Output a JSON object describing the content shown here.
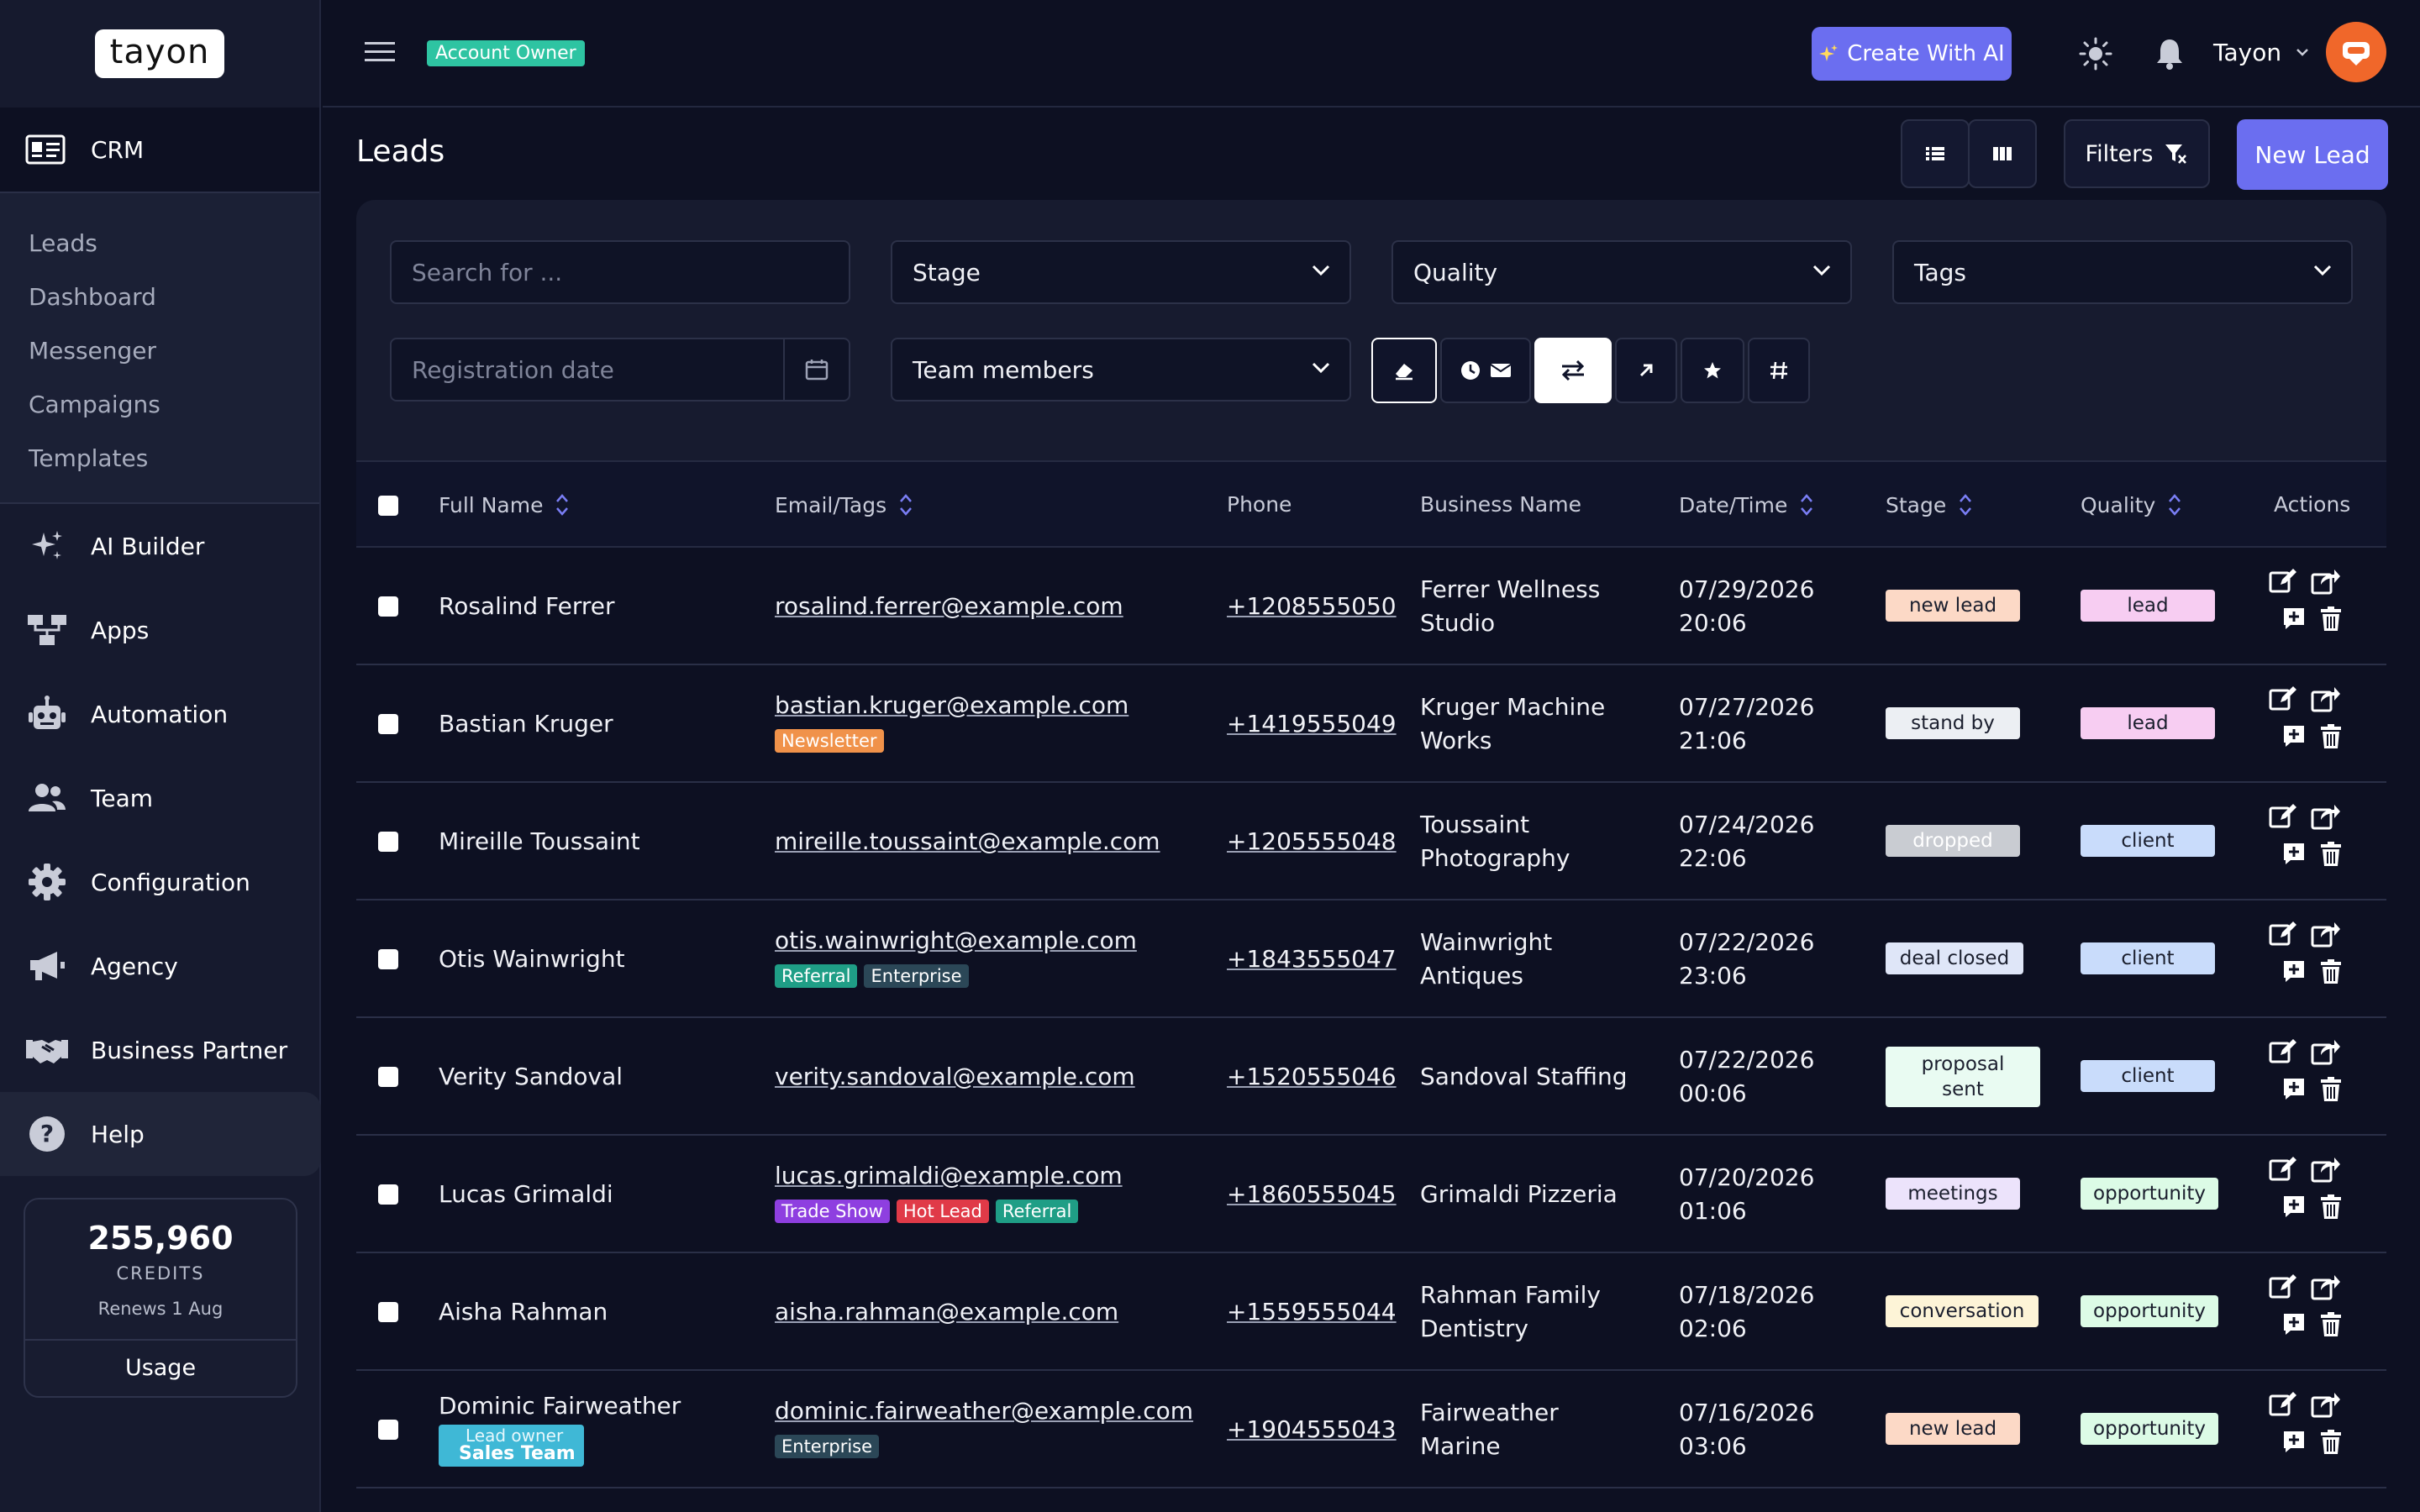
{
  "app": {
    "logo": "tayon"
  },
  "sidebar": {
    "section": "CRM",
    "sub_items": [
      "Leads",
      "Dashboard",
      "Messenger",
      "Campaigns",
      "Templates"
    ],
    "items": [
      {
        "label": "AI Builder",
        "icon": "sparkles-icon"
      },
      {
        "label": "Apps",
        "icon": "apps-icon"
      },
      {
        "label": "Automation",
        "icon": "robot-icon"
      },
      {
        "label": "Team",
        "icon": "team-icon"
      },
      {
        "label": "Configuration",
        "icon": "gear-icon"
      },
      {
        "label": "Agency",
        "icon": "megaphone-icon"
      },
      {
        "label": "Business Partner",
        "icon": "handshake-icon"
      },
      {
        "label": "Help",
        "icon": "help-icon"
      }
    ],
    "credits": {
      "value": "255,960",
      "label": "CREDITS",
      "renews": "Renews 1 Aug",
      "usage": "Usage"
    }
  },
  "topbar": {
    "badge": "Account Owner",
    "create_ai": "Create With AI",
    "user": "Tayon"
  },
  "header": {
    "title": "Leads",
    "filters": "Filters",
    "new_lead": "New Lead"
  },
  "filters": {
    "search_placeholder": "Search for ...",
    "stage": "Stage",
    "quality": "Quality",
    "tags": "Tags",
    "registration_placeholder": "Registration date",
    "team_members": "Team members"
  },
  "table": {
    "columns": [
      "Full Name",
      "Email/Tags",
      "Phone",
      "Business Name",
      "Date/Time",
      "Stage",
      "Quality",
      "Actions"
    ],
    "rows": [
      {
        "name": "Rosalind Ferrer",
        "email": "rosalind.ferrer@example.com",
        "tags": [],
        "phone": "+1208555050",
        "business": [
          "Ferrer Wellness",
          "Studio"
        ],
        "date": "07/29/2026",
        "time": "20:06",
        "stage": "new lead",
        "quality": "lead"
      },
      {
        "name": "Bastian Kruger",
        "email": "bastian.kruger@example.com",
        "tags": [
          "Newsletter"
        ],
        "phone": "+1419555049",
        "business": [
          "Kruger Machine",
          "Works"
        ],
        "date": "07/27/2026",
        "time": "21:06",
        "stage": "stand by",
        "quality": "lead"
      },
      {
        "name": "Mireille Toussaint",
        "email": "mireille.toussaint@example.com",
        "tags": [],
        "phone": "+1205555048",
        "business": [
          "Toussaint",
          "Photography"
        ],
        "date": "07/24/2026",
        "time": "22:06",
        "stage": "dropped",
        "quality": "client"
      },
      {
        "name": "Otis Wainwright",
        "email": "otis.wainwright@example.com",
        "tags": [
          "Referral",
          "Enterprise"
        ],
        "phone": "+1843555047",
        "business": [
          "Wainwright",
          "Antiques"
        ],
        "date": "07/22/2026",
        "time": "23:06",
        "stage": "deal closed",
        "quality": "client"
      },
      {
        "name": "Verity Sandoval",
        "email": "verity.sandoval@example.com",
        "tags": [],
        "phone": "+1520555046",
        "business": [
          "Sandoval Staffing"
        ],
        "date": "07/22/2026",
        "time": "00:06",
        "stage": "proposal sent",
        "quality": "client"
      },
      {
        "name": "Lucas Grimaldi",
        "email": "lucas.grimaldi@example.com",
        "tags": [
          "Trade Show",
          "Hot Lead",
          "Referral"
        ],
        "phone": "+1860555045",
        "business": [
          "Grimaldi Pizzeria"
        ],
        "date": "07/20/2026",
        "time": "01:06",
        "stage": "meetings",
        "quality": "opportunity"
      },
      {
        "name": "Aisha Rahman",
        "email": "aisha.rahman@example.com",
        "tags": [],
        "phone": "+1559555044",
        "business": [
          "Rahman Family",
          "Dentistry"
        ],
        "date": "07/18/2026",
        "time": "02:06",
        "stage": "conversation",
        "quality": "opportunity"
      },
      {
        "name": "Dominic Fairweather",
        "owner_label": "Lead owner",
        "owner_team": "Sales Team",
        "email": "dominic.fairweather@example.com",
        "tags": [
          "Enterprise"
        ],
        "phone": "+1904555043",
        "business": [
          "Fairweather",
          "Marine"
        ],
        "date": "07/16/2026",
        "time": "03:06",
        "stage": "new lead",
        "quality": "opportunity"
      }
    ]
  },
  "colors": {
    "accent": "#6b6ef0",
    "badge": "#2ec4a2",
    "tag_Newsletter": "#f0924a",
    "tag_Referral": "#1f9e86",
    "tag_Enterprise": "#2b4757",
    "tag_Trade Show": "#8e3fe0",
    "tag_Hot Lead": "#e03a48",
    "stage_new lead": "#fcd9c6",
    "stage_stand by": "#eceff3",
    "stage_dropped": "#c9ccd2",
    "stage_deal closed": "#dfe6f8",
    "stage_proposal sent": "#e9fbf2",
    "stage_meetings": "#ece3fb",
    "stage_conversation": "#fdf4d7",
    "quality_lead": "#f7cdf2",
    "quality_client": "#c9dcfb",
    "quality_opportunity": "#dcfbe6"
  }
}
